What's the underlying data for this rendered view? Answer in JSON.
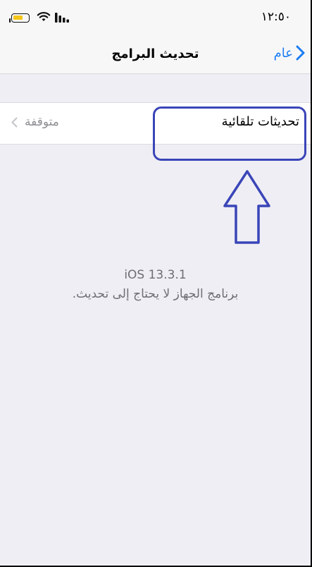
{
  "status_bar": {
    "time": "١٢:٥٠"
  },
  "nav": {
    "title": "تحديث البرامج",
    "back_label": "عام"
  },
  "auto_updates_row": {
    "label": "تحديثات تلقائية",
    "value": "متوقفة"
  },
  "software": {
    "version": "iOS 13.3.1",
    "status": "برنامج الجهاز لا يحتاج إلى تحديث."
  },
  "colors": {
    "accent": "#1a7cf2",
    "annotation": "#3a45b8",
    "battery": "#f5c518"
  },
  "icons": [
    "battery-icon",
    "wifi-icon",
    "signal-icon",
    "chevron-left-icon",
    "chevron-right-icon",
    "arrow-up-annotation"
  ]
}
